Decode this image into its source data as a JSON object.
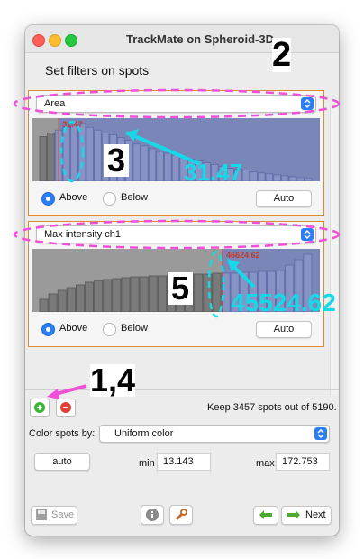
{
  "window": {
    "title": "TrackMate on Spheroid-3D"
  },
  "heading": "Set filters on spots",
  "filters": [
    {
      "feature": "Area",
      "threshold_label": "31.47",
      "above_label": "Above",
      "below_label": "Below",
      "selected": "Above",
      "auto_label": "Auto",
      "bars": [
        48,
        52,
        55,
        58,
        60,
        62,
        58,
        55,
        52,
        50,
        47,
        44,
        40,
        38,
        35,
        32,
        30,
        28,
        26,
        24,
        22,
        20,
        18,
        16,
        14,
        13,
        12,
        10,
        9,
        8,
        7,
        6,
        5,
        4,
        3
      ],
      "threshold_fraction": 0.07
    },
    {
      "feature": "Max intensity ch1",
      "threshold_label": "46624.62",
      "above_label": "Above",
      "below_label": "Below",
      "selected": "Above",
      "auto_label": "Auto",
      "bars": [
        14,
        20,
        24,
        27,
        30,
        33,
        35,
        36,
        37,
        38,
        39,
        39,
        40,
        40,
        41,
        41,
        42,
        42,
        42,
        43,
        43,
        43,
        44,
        44,
        45,
        45,
        46,
        52,
        58,
        64
      ],
      "threshold_fraction": 0.67
    }
  ],
  "summary": {
    "text": "Keep 3457 spots out of  5190."
  },
  "color": {
    "label": "Color spots by:",
    "selected": "Uniform color",
    "auto_label": "auto",
    "min_label": "min",
    "min_value": "13.143",
    "max_label": "max",
    "max_value": "172.753"
  },
  "footer": {
    "save_label": "Save",
    "next_label": "Next"
  },
  "annotations": {
    "label_2": "2",
    "label_3": "3",
    "label_5": "5",
    "label_14": "1,4",
    "value_31": "31.47",
    "value_45": "45524.62"
  },
  "colors": {
    "accent": "#2a7ff7",
    "panel_border": "#e08a30",
    "hist_selected": "#7a86b8",
    "hist_unselected": "#9a9a9a",
    "annot_magenta": "#f050d8",
    "annot_cyan": "#16d9e8"
  }
}
